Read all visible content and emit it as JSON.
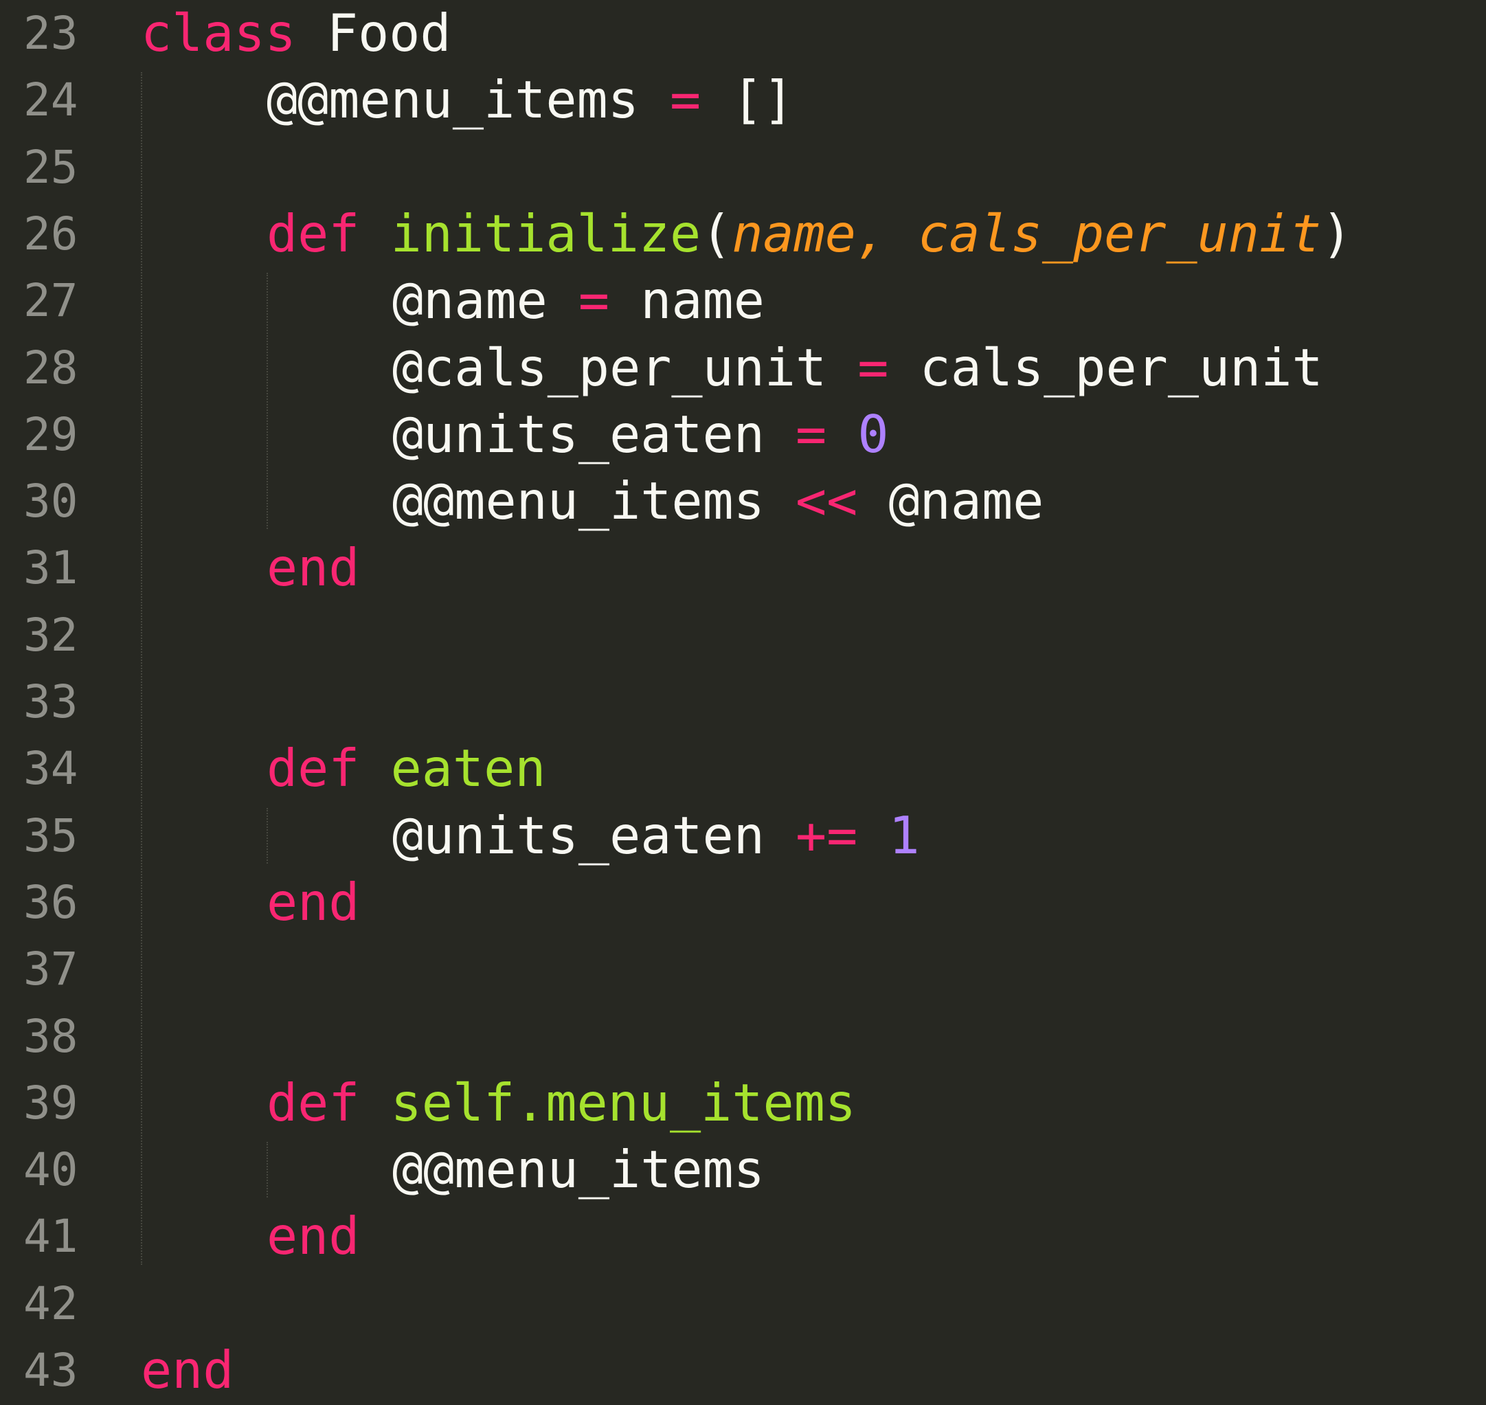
{
  "colors": {
    "background": "#272822",
    "gutter_text": "#90908a",
    "plain": "#f8f8f2",
    "keyword": "#f92672",
    "function_name": "#a6e22e",
    "parameter": "#fd971f",
    "number": "#ae81ff",
    "indent_guide": "#46473f"
  },
  "lines": [
    {
      "num": "23",
      "indent": 0,
      "tokens": [
        {
          "t": "class",
          "c": "keyword"
        },
        {
          "t": " Food",
          "c": "plain"
        }
      ]
    },
    {
      "num": "24",
      "indent": 1,
      "tokens": [
        {
          "t": "@@menu_items",
          "c": "plain"
        },
        {
          "t": " = ",
          "c": "keyword"
        },
        {
          "t": "[]",
          "c": "plain"
        }
      ]
    },
    {
      "num": "25",
      "indent": 0,
      "tokens": []
    },
    {
      "num": "26",
      "indent": 1,
      "tokens": [
        {
          "t": "def",
          "c": "keyword"
        },
        {
          "t": " ",
          "c": "plain"
        },
        {
          "t": "initialize",
          "c": "function_name"
        },
        {
          "t": "(",
          "c": "plain"
        },
        {
          "t": "name, cals_per_unit",
          "c": "parameter",
          "italic": true
        },
        {
          "t": ")",
          "c": "plain"
        }
      ]
    },
    {
      "num": "27",
      "indent": 2,
      "tokens": [
        {
          "t": "@name",
          "c": "plain"
        },
        {
          "t": " = ",
          "c": "keyword"
        },
        {
          "t": "name",
          "c": "plain"
        }
      ]
    },
    {
      "num": "28",
      "indent": 2,
      "tokens": [
        {
          "t": "@cals_per_unit",
          "c": "plain"
        },
        {
          "t": " = ",
          "c": "keyword"
        },
        {
          "t": "cals_per_unit",
          "c": "plain"
        }
      ]
    },
    {
      "num": "29",
      "indent": 2,
      "tokens": [
        {
          "t": "@units_eaten",
          "c": "plain"
        },
        {
          "t": " = ",
          "c": "keyword"
        },
        {
          "t": "0",
          "c": "number"
        }
      ]
    },
    {
      "num": "30",
      "indent": 2,
      "tokens": [
        {
          "t": "@@menu_items",
          "c": "plain"
        },
        {
          "t": " << ",
          "c": "keyword"
        },
        {
          "t": "@name",
          "c": "plain"
        }
      ]
    },
    {
      "num": "31",
      "indent": 1,
      "tokens": [
        {
          "t": "end",
          "c": "keyword"
        }
      ]
    },
    {
      "num": "32",
      "indent": 0,
      "tokens": []
    },
    {
      "num": "33",
      "indent": 0,
      "tokens": []
    },
    {
      "num": "34",
      "indent": 1,
      "tokens": [
        {
          "t": "def",
          "c": "keyword"
        },
        {
          "t": " ",
          "c": "plain"
        },
        {
          "t": "eaten",
          "c": "function_name"
        }
      ]
    },
    {
      "num": "35",
      "indent": 2,
      "tokens": [
        {
          "t": "@units_eaten",
          "c": "plain"
        },
        {
          "t": " += ",
          "c": "keyword"
        },
        {
          "t": "1",
          "c": "number"
        }
      ]
    },
    {
      "num": "36",
      "indent": 1,
      "tokens": [
        {
          "t": "end",
          "c": "keyword"
        }
      ]
    },
    {
      "num": "37",
      "indent": 0,
      "tokens": []
    },
    {
      "num": "38",
      "indent": 0,
      "tokens": []
    },
    {
      "num": "39",
      "indent": 1,
      "tokens": [
        {
          "t": "def",
          "c": "keyword"
        },
        {
          "t": " ",
          "c": "plain"
        },
        {
          "t": "self.menu_items",
          "c": "function_name"
        }
      ]
    },
    {
      "num": "40",
      "indent": 2,
      "tokens": [
        {
          "t": "@@menu_items",
          "c": "plain"
        }
      ]
    },
    {
      "num": "41",
      "indent": 1,
      "tokens": [
        {
          "t": "end",
          "c": "keyword"
        }
      ]
    },
    {
      "num": "42",
      "indent": 0,
      "tokens": []
    },
    {
      "num": "43",
      "indent": 0,
      "tokens": [
        {
          "t": "end",
          "c": "keyword"
        }
      ]
    }
  ]
}
